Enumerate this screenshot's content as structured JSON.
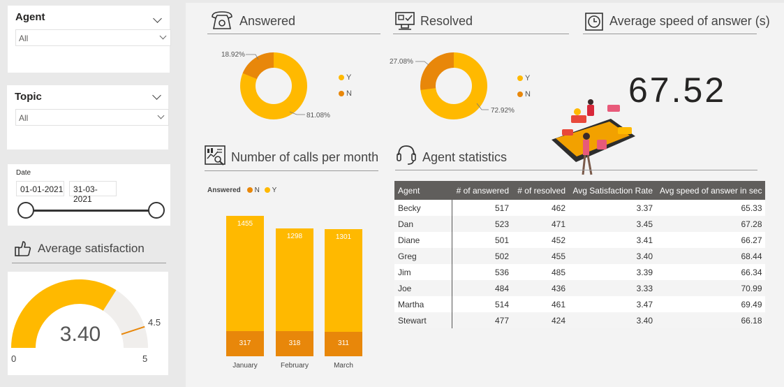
{
  "colors": {
    "yellow": "#FFB900",
    "orange": "#E8870A",
    "gauge_track": "#F0EEEC"
  },
  "filters": {
    "agent": {
      "label": "Agent",
      "value": "All"
    },
    "topic": {
      "label": "Topic",
      "value": "All"
    },
    "date": {
      "label": "Date",
      "start": "01-01-2021",
      "end": "31-03-2021"
    }
  },
  "satisfaction": {
    "title": "Average satisfaction",
    "value_label": "3.40",
    "value": 3.4,
    "min_label": "0",
    "max_label": "5",
    "target_label": "4.5",
    "min": 0,
    "max": 5,
    "target": 4.5
  },
  "answered": {
    "title": "Answered",
    "icon": "telephone-icon",
    "legend": [
      "Y",
      "N"
    ],
    "y_label": "81.08%",
    "n_label": "18.92%",
    "y_fraction": 0.8108,
    "n_fraction": 0.1892
  },
  "resolved": {
    "title": "Resolved",
    "icon": "monitor-check-icon",
    "legend": [
      "Y",
      "N"
    ],
    "y_label": "72.92%",
    "n_label": "27.08%",
    "y_fraction": 0.7292,
    "n_fraction": 0.2708
  },
  "speed": {
    "title": "Average speed of answer (s)",
    "icon": "clock-icon",
    "value": "67.52"
  },
  "calls": {
    "title": "Number of calls per month",
    "icon": "chart-report-icon",
    "legend_title": "Answered",
    "legend": [
      "N",
      "Y"
    ]
  },
  "chart_data": {
    "type": "bar",
    "stacked": true,
    "categories": [
      "January",
      "February",
      "March"
    ],
    "series": [
      {
        "name": "N",
        "values": [
          317,
          318,
          311
        ],
        "color": "#E8870A"
      },
      {
        "name": "Y",
        "values": [
          1455,
          1298,
          1301
        ],
        "color": "#FFB900"
      }
    ],
    "legend_title": "Answered",
    "legend_placement": "top-left",
    "grid": false
  },
  "agent_stats": {
    "title": "Agent statistics",
    "icon": "headset-icon",
    "columns": [
      "Agent",
      "# of answered",
      "# of resolved",
      "Avg Satisfaction Rate",
      "Avg speed of answer in sec"
    ],
    "rows": [
      [
        "Becky",
        "517",
        "462",
        "3.37",
        "65.33"
      ],
      [
        "Dan",
        "523",
        "471",
        "3.45",
        "67.28"
      ],
      [
        "Diane",
        "501",
        "452",
        "3.41",
        "66.27"
      ],
      [
        "Greg",
        "502",
        "455",
        "3.40",
        "68.44"
      ],
      [
        "Jim",
        "536",
        "485",
        "3.39",
        "66.34"
      ],
      [
        "Joe",
        "484",
        "436",
        "3.33",
        "70.99"
      ],
      [
        "Martha",
        "514",
        "461",
        "3.47",
        "69.49"
      ],
      [
        "Stewart",
        "477",
        "424",
        "3.40",
        "66.18"
      ]
    ]
  }
}
